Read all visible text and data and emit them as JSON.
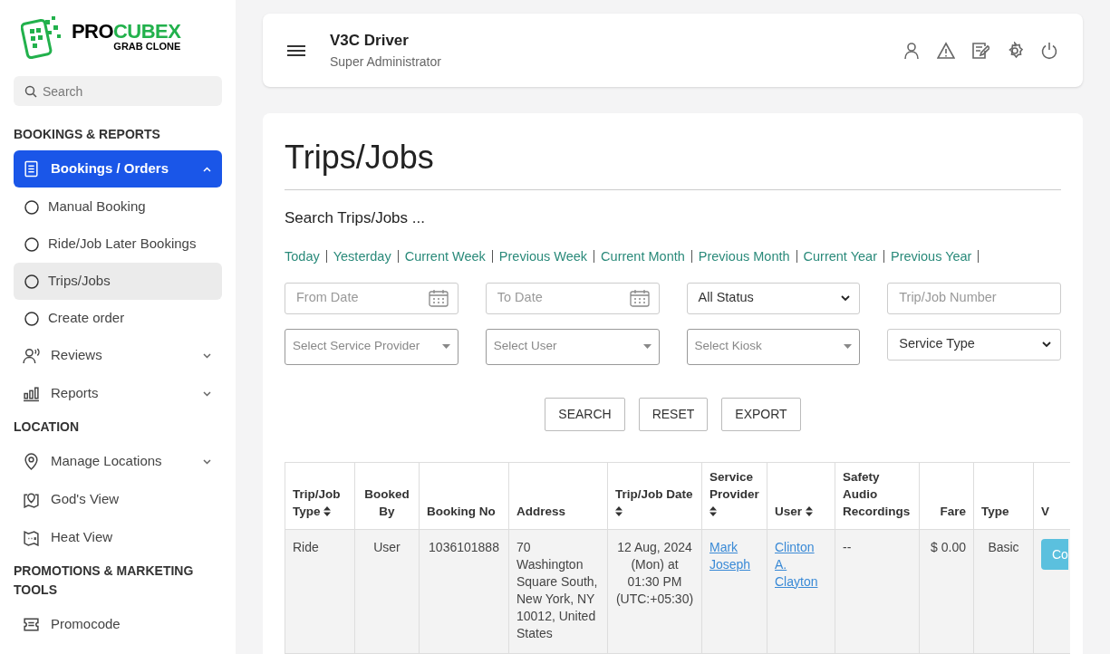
{
  "logo": {
    "brand_dark": "PRO",
    "brand_green": "CUBEX",
    "tagline": "GRAB CLONE"
  },
  "sidebar": {
    "search": {
      "placeholder": "Search"
    },
    "sections": [
      {
        "heading": "BOOKINGS & REPORTS",
        "items": [
          {
            "label": "Bookings / Orders",
            "kind": "document",
            "selected": true,
            "expanded": true,
            "children": [
              {
                "label": "Manual Booking",
                "selected": false
              },
              {
                "label": "Ride/Job Later Bookings",
                "selected": false
              },
              {
                "label": "Trips/Jobs",
                "selected": true
              },
              {
                "label": "Create order",
                "selected": false
              }
            ]
          },
          {
            "label": "Reviews",
            "kind": "reviews",
            "selected": false,
            "expanded": false
          },
          {
            "label": "Reports",
            "kind": "chart",
            "selected": false,
            "expanded": false
          }
        ]
      },
      {
        "heading": "LOCATION",
        "items": [
          {
            "label": "Manage Locations",
            "kind": "pin",
            "selected": false,
            "expanded": false
          },
          {
            "label": "God's View",
            "kind": "map-pin",
            "selected": false
          },
          {
            "label": "Heat View",
            "kind": "map",
            "selected": false
          }
        ]
      },
      {
        "heading": "PROMOTIONS & MARKETING TOOLS",
        "items": [
          {
            "label": "Promocode",
            "kind": "ticket",
            "selected": false
          }
        ]
      }
    ]
  },
  "header": {
    "title": "V3C Driver",
    "subtitle": "Super Administrator"
  },
  "page": {
    "title": "Trips/Jobs",
    "search_title": "Search Trips/Jobs ...",
    "date_presets": [
      "Today",
      "Yesterday",
      "Current Week",
      "Previous Week",
      "Current Month",
      "Previous Month",
      "Current Year",
      "Previous Year"
    ],
    "filters": [
      {
        "kind": "date",
        "placeholder": "From Date"
      },
      {
        "kind": "date",
        "placeholder": "To Date"
      },
      {
        "kind": "select",
        "value": "All Status"
      },
      {
        "kind": "input",
        "placeholder": "Trip/Job Number"
      },
      {
        "kind": "combo",
        "placeholder": "Select Service Provider"
      },
      {
        "kind": "combo",
        "placeholder": "Select User"
      },
      {
        "kind": "combo",
        "placeholder": "Select Kiosk"
      },
      {
        "kind": "select",
        "value": "Service Type"
      }
    ],
    "buttons": [
      "SEARCH",
      "RESET",
      "EXPORT"
    ]
  },
  "table": {
    "columns": [
      {
        "label": "Trip/Job Type",
        "sortable": true
      },
      {
        "label": "Booked By",
        "sortable": false
      },
      {
        "label": "Booking No",
        "sortable": false
      },
      {
        "label": "Address",
        "sortable": false
      },
      {
        "label": "Trip/Job Date",
        "sortable": true
      },
      {
        "label": "Service Provider",
        "sortable": true
      },
      {
        "label": "User",
        "sortable": true
      },
      {
        "label": "Safety Audio Recordings",
        "sortable": false
      },
      {
        "label": "Fare",
        "sortable": false
      },
      {
        "label": "Type",
        "sortable": false
      },
      {
        "label": "V",
        "sortable": false
      }
    ],
    "rows": [
      {
        "cells": [
          {
            "kind": "text",
            "text": "Ride"
          },
          {
            "kind": "text",
            "text": "User"
          },
          {
            "kind": "text",
            "text": "1036101888"
          },
          {
            "kind": "text",
            "text": "70 Washington Square South, New York, NY 10012, United States"
          },
          {
            "kind": "text",
            "text": "12 Aug, 2024 (Mon) at 01:30 PM (UTC:+05:30)"
          },
          {
            "kind": "link",
            "text": "Mark Joseph"
          },
          {
            "kind": "link",
            "text": "Clinton A. Clayton"
          },
          {
            "kind": "text",
            "text": "--"
          },
          {
            "kind": "text",
            "text": "$ 0.00"
          },
          {
            "kind": "text",
            "text": "Basic"
          },
          {
            "kind": "button",
            "text": "Co"
          }
        ]
      }
    ]
  }
}
